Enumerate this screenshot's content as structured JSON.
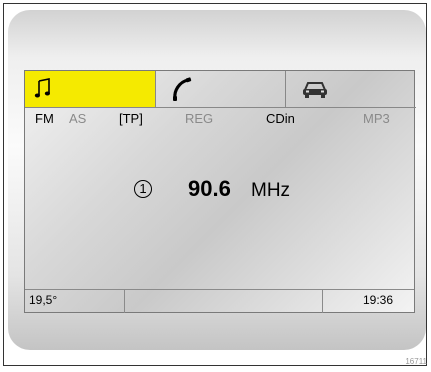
{
  "tabs": [
    {
      "name": "music",
      "icon": "music-note-icon",
      "active": true
    },
    {
      "name": "phone",
      "icon": "phone-handset-icon",
      "active": false
    },
    {
      "name": "vehicle",
      "icon": "car-icon",
      "active": false
    }
  ],
  "status": {
    "fm": "FM",
    "as": "AS",
    "tp": "[TP]",
    "reg": "REG",
    "cdin": "CDin",
    "mp3": "MP3"
  },
  "radio": {
    "preset": "1",
    "frequency": "90.6",
    "unit": "MHz"
  },
  "bottom_bar": {
    "temperature": "19,5°",
    "center": "",
    "time": "19:36"
  },
  "figure_code": "16711",
  "colors": {
    "active_tab": "#f5ea00",
    "inactive_text": "#8a8a8a"
  }
}
